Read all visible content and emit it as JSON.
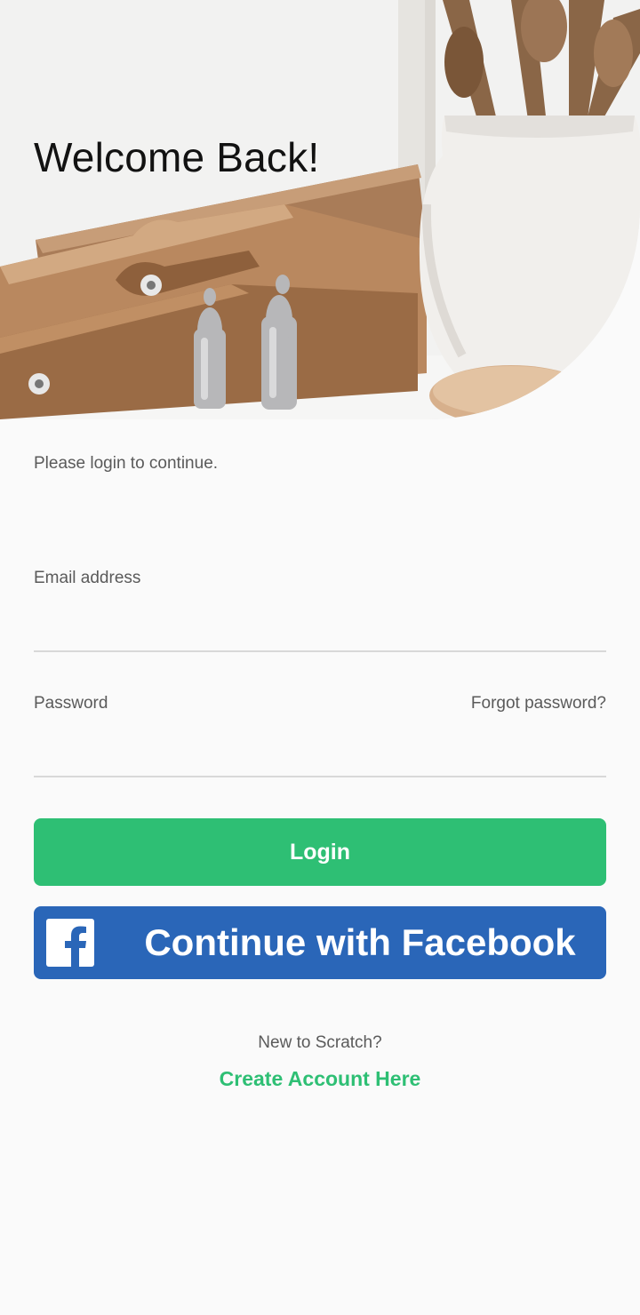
{
  "hero": {
    "title": "Welcome Back!",
    "image": "kitchen-still-life-photo"
  },
  "form": {
    "subtitle": "Please login to continue.",
    "email": {
      "label": "Email address",
      "value": "",
      "placeholder": ""
    },
    "password": {
      "label": "Password",
      "value": "",
      "placeholder": ""
    },
    "forgot_label": "Forgot password?",
    "login_label": "Login"
  },
  "facebook": {
    "label": "Continue with Facebook",
    "icon": "facebook-logo-icon",
    "color": "#2a66b8"
  },
  "signup": {
    "prompt": "New to Scratch?",
    "link_label": "Create Account Here"
  },
  "colors": {
    "accent": "#2ebf74",
    "background": "#fafafa",
    "muted_text": "#5a5a5a"
  }
}
